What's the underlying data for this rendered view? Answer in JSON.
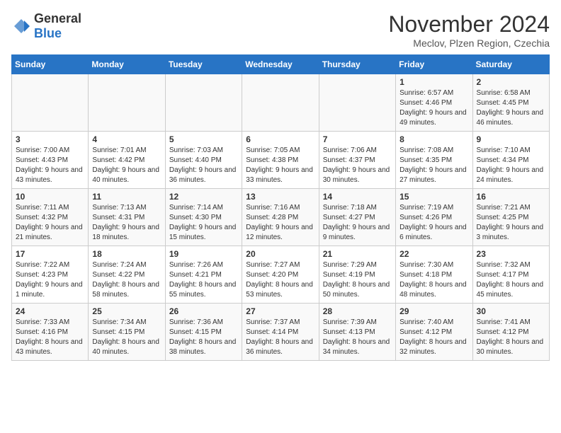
{
  "logo": {
    "text_general": "General",
    "text_blue": "Blue"
  },
  "header": {
    "month_title": "November 2024",
    "location": "Meclov, Plzen Region, Czechia"
  },
  "days_of_week": [
    "Sunday",
    "Monday",
    "Tuesday",
    "Wednesday",
    "Thursday",
    "Friday",
    "Saturday"
  ],
  "weeks": [
    [
      {
        "day": "",
        "info": ""
      },
      {
        "day": "",
        "info": ""
      },
      {
        "day": "",
        "info": ""
      },
      {
        "day": "",
        "info": ""
      },
      {
        "day": "",
        "info": ""
      },
      {
        "day": "1",
        "info": "Sunrise: 6:57 AM\nSunset: 4:46 PM\nDaylight: 9 hours and 49 minutes."
      },
      {
        "day": "2",
        "info": "Sunrise: 6:58 AM\nSunset: 4:45 PM\nDaylight: 9 hours and 46 minutes."
      }
    ],
    [
      {
        "day": "3",
        "info": "Sunrise: 7:00 AM\nSunset: 4:43 PM\nDaylight: 9 hours and 43 minutes."
      },
      {
        "day": "4",
        "info": "Sunrise: 7:01 AM\nSunset: 4:42 PM\nDaylight: 9 hours and 40 minutes."
      },
      {
        "day": "5",
        "info": "Sunrise: 7:03 AM\nSunset: 4:40 PM\nDaylight: 9 hours and 36 minutes."
      },
      {
        "day": "6",
        "info": "Sunrise: 7:05 AM\nSunset: 4:38 PM\nDaylight: 9 hours and 33 minutes."
      },
      {
        "day": "7",
        "info": "Sunrise: 7:06 AM\nSunset: 4:37 PM\nDaylight: 9 hours and 30 minutes."
      },
      {
        "day": "8",
        "info": "Sunrise: 7:08 AM\nSunset: 4:35 PM\nDaylight: 9 hours and 27 minutes."
      },
      {
        "day": "9",
        "info": "Sunrise: 7:10 AM\nSunset: 4:34 PM\nDaylight: 9 hours and 24 minutes."
      }
    ],
    [
      {
        "day": "10",
        "info": "Sunrise: 7:11 AM\nSunset: 4:32 PM\nDaylight: 9 hours and 21 minutes."
      },
      {
        "day": "11",
        "info": "Sunrise: 7:13 AM\nSunset: 4:31 PM\nDaylight: 9 hours and 18 minutes."
      },
      {
        "day": "12",
        "info": "Sunrise: 7:14 AM\nSunset: 4:30 PM\nDaylight: 9 hours and 15 minutes."
      },
      {
        "day": "13",
        "info": "Sunrise: 7:16 AM\nSunset: 4:28 PM\nDaylight: 9 hours and 12 minutes."
      },
      {
        "day": "14",
        "info": "Sunrise: 7:18 AM\nSunset: 4:27 PM\nDaylight: 9 hours and 9 minutes."
      },
      {
        "day": "15",
        "info": "Sunrise: 7:19 AM\nSunset: 4:26 PM\nDaylight: 9 hours and 6 minutes."
      },
      {
        "day": "16",
        "info": "Sunrise: 7:21 AM\nSunset: 4:25 PM\nDaylight: 9 hours and 3 minutes."
      }
    ],
    [
      {
        "day": "17",
        "info": "Sunrise: 7:22 AM\nSunset: 4:23 PM\nDaylight: 9 hours and 1 minute."
      },
      {
        "day": "18",
        "info": "Sunrise: 7:24 AM\nSunset: 4:22 PM\nDaylight: 8 hours and 58 minutes."
      },
      {
        "day": "19",
        "info": "Sunrise: 7:26 AM\nSunset: 4:21 PM\nDaylight: 8 hours and 55 minutes."
      },
      {
        "day": "20",
        "info": "Sunrise: 7:27 AM\nSunset: 4:20 PM\nDaylight: 8 hours and 53 minutes."
      },
      {
        "day": "21",
        "info": "Sunrise: 7:29 AM\nSunset: 4:19 PM\nDaylight: 8 hours and 50 minutes."
      },
      {
        "day": "22",
        "info": "Sunrise: 7:30 AM\nSunset: 4:18 PM\nDaylight: 8 hours and 48 minutes."
      },
      {
        "day": "23",
        "info": "Sunrise: 7:32 AM\nSunset: 4:17 PM\nDaylight: 8 hours and 45 minutes."
      }
    ],
    [
      {
        "day": "24",
        "info": "Sunrise: 7:33 AM\nSunset: 4:16 PM\nDaylight: 8 hours and 43 minutes."
      },
      {
        "day": "25",
        "info": "Sunrise: 7:34 AM\nSunset: 4:15 PM\nDaylight: 8 hours and 40 minutes."
      },
      {
        "day": "26",
        "info": "Sunrise: 7:36 AM\nSunset: 4:15 PM\nDaylight: 8 hours and 38 minutes."
      },
      {
        "day": "27",
        "info": "Sunrise: 7:37 AM\nSunset: 4:14 PM\nDaylight: 8 hours and 36 minutes."
      },
      {
        "day": "28",
        "info": "Sunrise: 7:39 AM\nSunset: 4:13 PM\nDaylight: 8 hours and 34 minutes."
      },
      {
        "day": "29",
        "info": "Sunrise: 7:40 AM\nSunset: 4:12 PM\nDaylight: 8 hours and 32 minutes."
      },
      {
        "day": "30",
        "info": "Sunrise: 7:41 AM\nSunset: 4:12 PM\nDaylight: 8 hours and 30 minutes."
      }
    ]
  ]
}
